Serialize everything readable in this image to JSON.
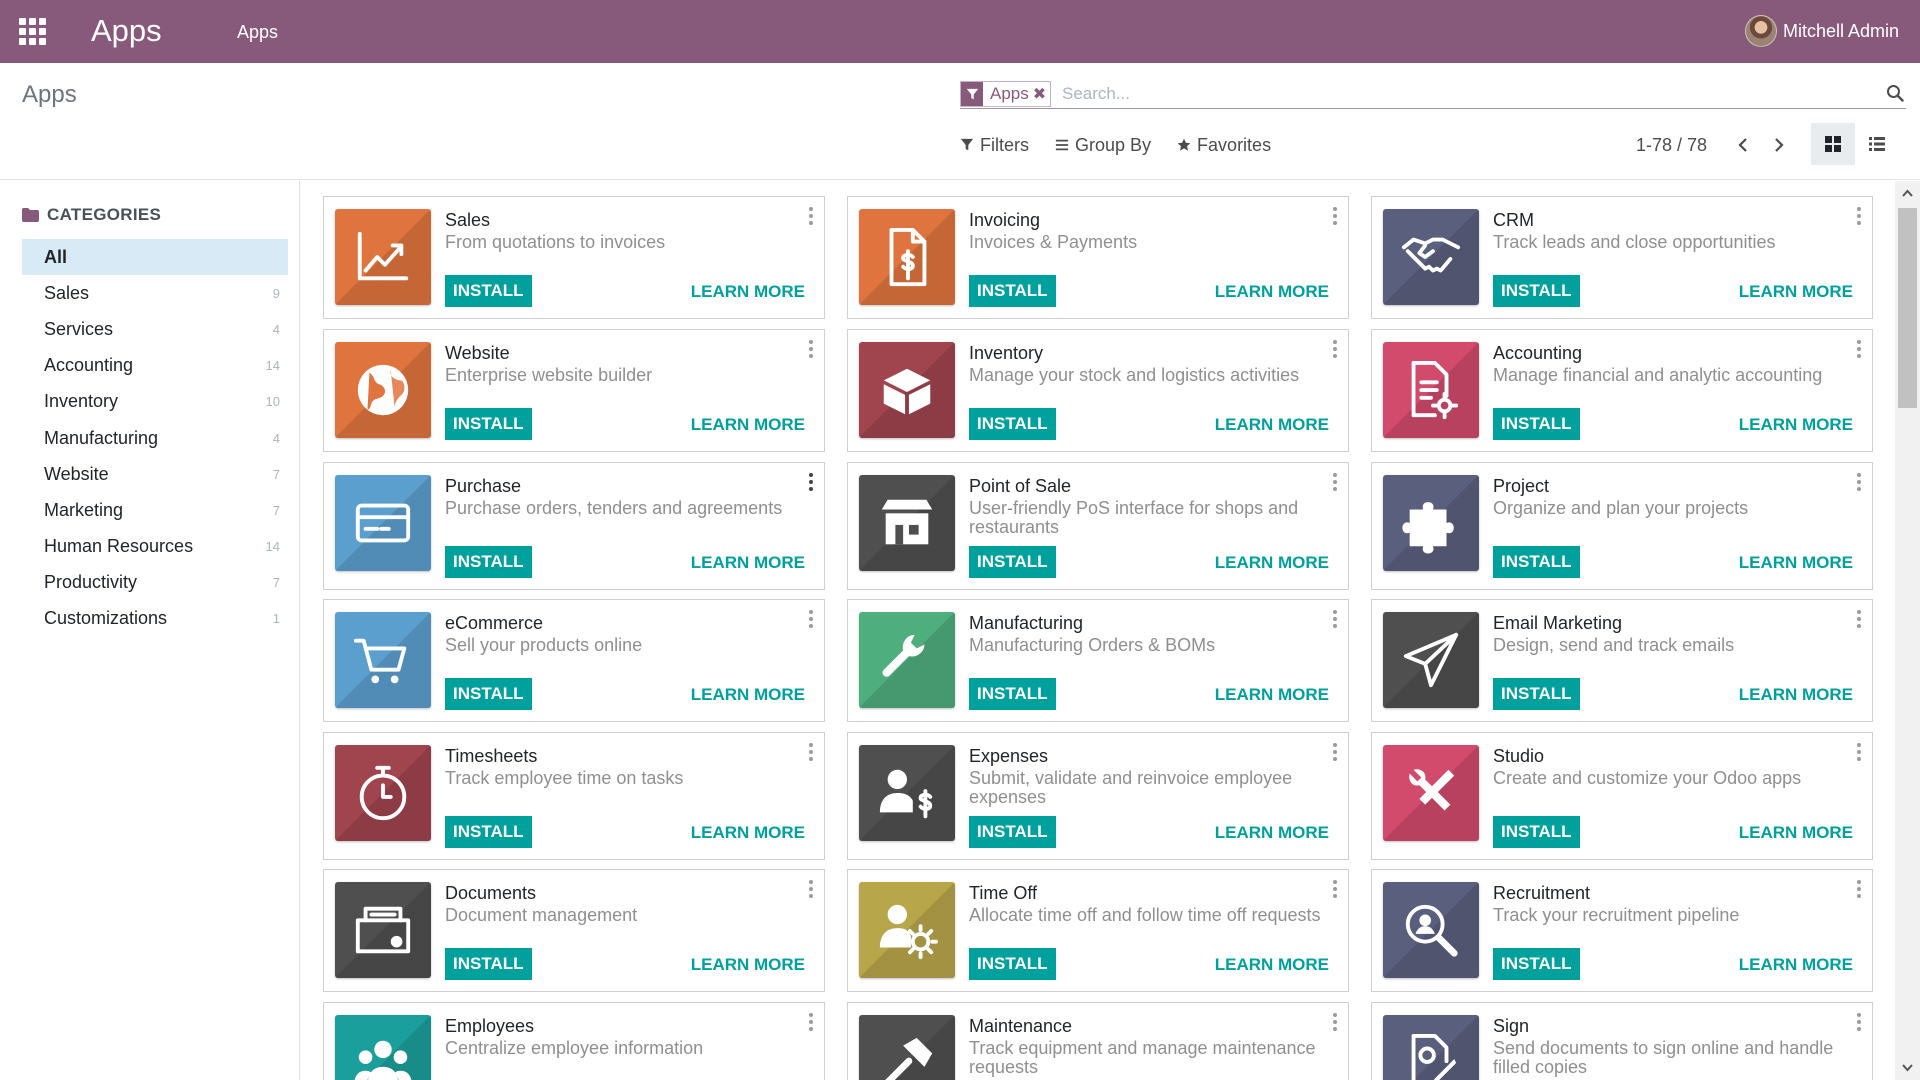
{
  "navbar": {
    "brand": "Apps",
    "menu_item": "Apps",
    "user_name": "Mitchell Admin",
    "bg_color": "#875a7b"
  },
  "control_panel": {
    "breadcrumb": "Apps",
    "search": {
      "facet_label": "Apps",
      "facet_close": "✖",
      "placeholder": "Search..."
    },
    "options": {
      "filters": "Filters",
      "group_by": "Group By",
      "favorites": "Favorites"
    },
    "pager": {
      "value": "1-78 / 78"
    }
  },
  "sidebar": {
    "title": "CATEGORIES",
    "items": [
      {
        "label": "All",
        "count": ""
      },
      {
        "label": "Sales",
        "count": "9"
      },
      {
        "label": "Services",
        "count": "4"
      },
      {
        "label": "Accounting",
        "count": "14"
      },
      {
        "label": "Inventory",
        "count": "10"
      },
      {
        "label": "Manufacturing",
        "count": "4"
      },
      {
        "label": "Website",
        "count": "7"
      },
      {
        "label": "Marketing",
        "count": "7"
      },
      {
        "label": "Human Resources",
        "count": "14"
      },
      {
        "label": "Productivity",
        "count": "7"
      },
      {
        "label": "Customizations",
        "count": "1"
      }
    ]
  },
  "buttons": {
    "install": "INSTALL",
    "learn_more": "LEARN MORE"
  },
  "apps": [
    {
      "name": "Sales",
      "summary": "From quotations to invoices",
      "icon": "trend-chart-icon",
      "color": "#e0743e"
    },
    {
      "name": "Invoicing",
      "summary": "Invoices & Payments",
      "icon": "invoice-dollar-icon",
      "color": "#e0743e"
    },
    {
      "name": "CRM",
      "summary": "Track leads and close opportunities",
      "icon": "handshake-icon",
      "color": "#5b5f7e"
    },
    {
      "name": "Website",
      "summary": "Enterprise website builder",
      "icon": "globe-icon",
      "color": "#e0743e"
    },
    {
      "name": "Inventory",
      "summary": "Manage your stock and logistics activities",
      "icon": "box-icon",
      "color": "#a0444e"
    },
    {
      "name": "Accounting",
      "summary": "Manage financial and analytic accounting",
      "icon": "document-gear-icon",
      "color": "#d24a6c"
    },
    {
      "name": "Purchase",
      "summary": "Purchase orders, tenders and agreements",
      "icon": "credit-card-icon",
      "color": "#5b9fce"
    },
    {
      "name": "Point of Sale",
      "summary": "User-friendly PoS interface for shops and restaurants",
      "icon": "store-icon",
      "color": "#4f4f4f"
    },
    {
      "name": "Project",
      "summary": "Organize and plan your projects",
      "icon": "puzzle-icon",
      "color": "#5b5f7e"
    },
    {
      "name": "eCommerce",
      "summary": "Sell your products online",
      "icon": "cart-icon",
      "color": "#5b9fce"
    },
    {
      "name": "Manufacturing",
      "summary": "Manufacturing Orders & BOMs",
      "icon": "wrench-icon",
      "color": "#4fae7d"
    },
    {
      "name": "Email Marketing",
      "summary": "Design, send and track emails",
      "icon": "paper-plane-icon",
      "color": "#4f4f4f"
    },
    {
      "name": "Timesheets",
      "summary": "Track employee time on tasks",
      "icon": "stopwatch-icon",
      "color": "#a0444e"
    },
    {
      "name": "Expenses",
      "summary": "Submit, validate and reinvoice employee expenses",
      "icon": "user-dollar-icon",
      "color": "#4f4f4f"
    },
    {
      "name": "Studio",
      "summary": "Create and customize your Odoo apps",
      "icon": "tools-icon",
      "color": "#d24a6c"
    },
    {
      "name": "Documents",
      "summary": "Document management",
      "icon": "file-tray-icon",
      "color": "#4f4f4f"
    },
    {
      "name": "Time Off",
      "summary": "Allocate time off and follow time off requests",
      "icon": "user-sun-icon",
      "color": "#b8a64a"
    },
    {
      "name": "Recruitment",
      "summary": "Track your recruitment pipeline",
      "icon": "magnifier-icon",
      "color": "#5b5f7e"
    },
    {
      "name": "Employees",
      "summary": "Centralize employee information",
      "icon": "users-group-icon",
      "color": "#1a9f9c"
    },
    {
      "name": "Maintenance",
      "summary": "Track equipment and manage maintenance requests",
      "icon": "hammer-icon",
      "color": "#4f4f4f"
    },
    {
      "name": "Sign",
      "summary": "Send documents to sign online and handle filled copies",
      "icon": "signature-icon",
      "color": "#5b5f7e"
    }
  ]
}
